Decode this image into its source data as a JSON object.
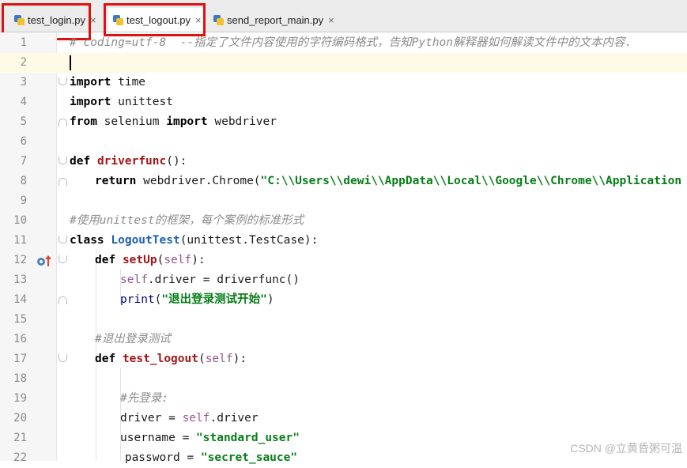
{
  "tabs": [
    {
      "label": "test_login.py",
      "close": "×"
    },
    {
      "label": "test_logout.py",
      "close": "×"
    },
    {
      "label": "send_report_main.py",
      "close": "×"
    }
  ],
  "editor": {
    "line_numbers": [
      "1",
      "2",
      "3",
      "4",
      "5",
      "6",
      "7",
      "8",
      "9",
      "10",
      "11",
      "12",
      "13",
      "14",
      "15",
      "16",
      "17",
      "18",
      "19",
      "20",
      "21",
      "22"
    ],
    "lines": {
      "l1": "# coding=utf-8  --指定了文件内容使用的字符编码格式，告知Python解释器如何解读文件中的文本内容.",
      "l3_kw": "import",
      "l3_rest": " time",
      "l4_kw": "import",
      "l4_rest": " unittest",
      "l5_kw1": "from",
      "l5_mid": " selenium ",
      "l5_kw2": "import",
      "l5_rest": " webdriver",
      "l7_kw": "def",
      "l7_fn": "driverfunc",
      "l7_rest": "():",
      "l8_kw": "return",
      "l8_mid": " webdriver.Chrome(",
      "l8_str": "\"C:\\\\Users\\\\dewi\\\\AppData\\\\Local\\\\Google\\\\Chrome\\\\Application",
      "l10": "#使用unittest的框架，每个案例的标准形式",
      "l11_kw": "class",
      "l11_cls": "LogoutTest",
      "l11_rest": "(unittest.TestCase):",
      "l12_kw": "def",
      "l12_fn": "setUp",
      "l12_p1": "(",
      "l12_self": "self",
      "l12_p2": "):",
      "l13_self": "self",
      "l13_rest": ".driver = driverfunc()",
      "l14_fn": "print",
      "l14_p1": "(",
      "l14_str": "\"退出登录测试开始\"",
      "l14_p2": ")",
      "l16": "#退出登录测试",
      "l17_kw": "def",
      "l17_fn": "test_logout",
      "l17_p1": "(",
      "l17_self": "self",
      "l17_p2": "):",
      "l19": "#先登录:",
      "l20_a": "driver = ",
      "l20_self": "self",
      "l20_b": ".driver",
      "l21_a": "username = ",
      "l21_str": "\"standard_user\"",
      "l22_a": "        password = ",
      "l22_str": "\"secret_sauce\""
    }
  },
  "watermark": "CSDN @立黄昏粥可温",
  "colors": {
    "highlight_box": "#e01010",
    "keyword": "#000080",
    "string": "#067d17",
    "comment": "#8c8c8c"
  }
}
